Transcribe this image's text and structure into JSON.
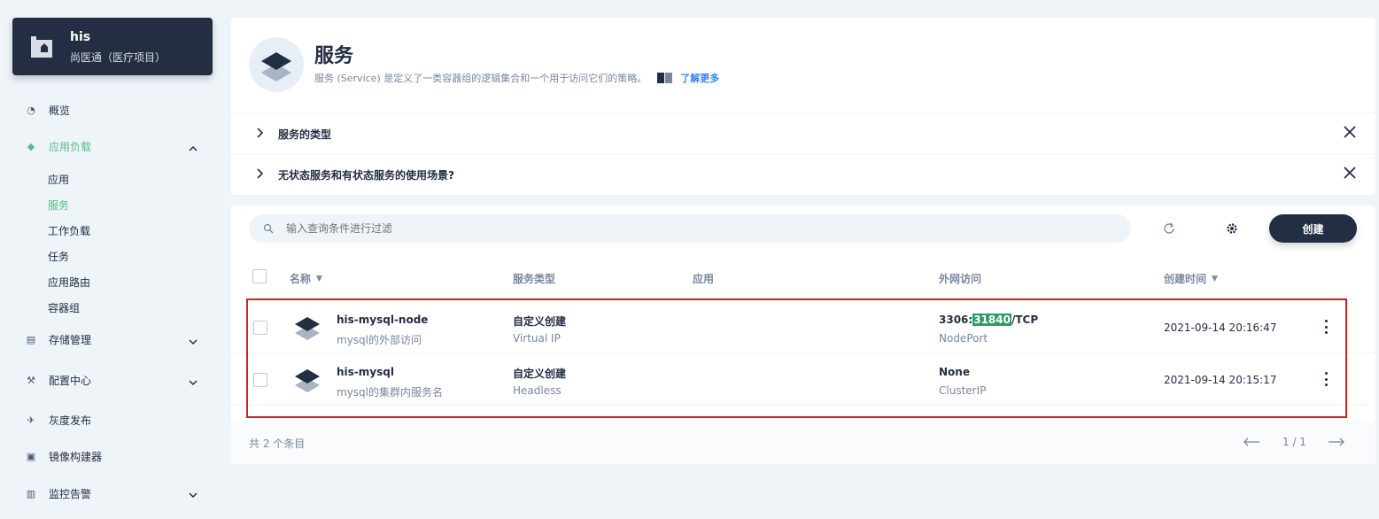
{
  "project": {
    "name": "his",
    "desc": "尚医通（医疗项目）"
  },
  "sidebar": {
    "items": [
      {
        "label": "概览",
        "icon": "dashboard-icon"
      },
      {
        "label": "应用负载",
        "icon": "layers-icon",
        "expanded": true
      },
      {
        "label": "存储管理",
        "icon": "database-icon"
      },
      {
        "label": "配置中心",
        "icon": "hammer-icon"
      },
      {
        "label": "灰度发布",
        "icon": "bird-icon"
      },
      {
        "label": "镜像构建器",
        "icon": "image-builder-icon"
      },
      {
        "label": "监控告警",
        "icon": "monitor-icon"
      }
    ],
    "subitems": [
      "应用",
      "服务",
      "工作负载",
      "任务",
      "应用路由",
      "容器组"
    ],
    "active_subitem": "服务"
  },
  "header": {
    "title": "服务",
    "desc": "服务 (Service) 是定义了一类容器组的逻辑集合和一个用于访问它们的策略。",
    "learn_more": "了解更多"
  },
  "tips": [
    {
      "label": "服务的类型"
    },
    {
      "label": "无状态服务和有状态服务的使用场景?"
    }
  ],
  "toolbar": {
    "search_placeholder": "输入查询条件进行过滤",
    "create_label": "创建"
  },
  "table": {
    "columns": [
      "名称",
      "服务类型",
      "应用",
      "外网访问",
      "创建时间"
    ],
    "rows": [
      {
        "name": "his-mysql-node",
        "desc": "mysql的外部访问",
        "type": "自定义创建",
        "type_sub": "Virtual IP",
        "app": "",
        "access_pre": "3306:",
        "access_hl": "31840",
        "access_post": "/TCP",
        "access_sub": "NodePort",
        "created": "2021-09-14 20:16:47"
      },
      {
        "name": "his-mysql",
        "desc": "mysql的集群内服务名",
        "type": "自定义创建",
        "type_sub": "Headless",
        "app": "",
        "access_pre": "None",
        "access_hl": "",
        "access_post": "",
        "access_sub": "ClusterIP",
        "created": "2021-09-14 20:15:17"
      }
    ]
  },
  "footer": {
    "total": "共 2 个条目",
    "page": "1 / 1"
  },
  "colors": {
    "accent": "#55bc8a",
    "dark": "#242e42",
    "highlight": "#d0211c"
  }
}
